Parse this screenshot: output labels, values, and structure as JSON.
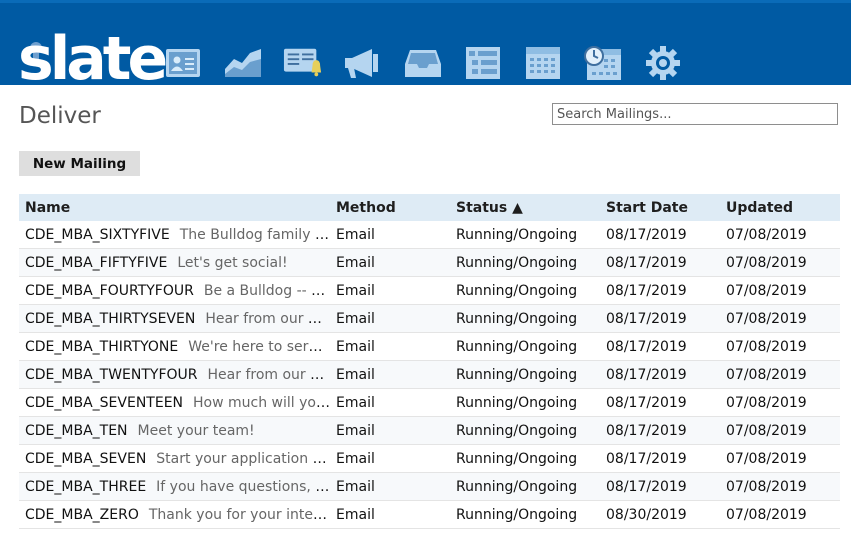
{
  "app": {
    "logo_text": "slate"
  },
  "nav": [
    {
      "name": "people-icon"
    },
    {
      "name": "reports-icon"
    },
    {
      "name": "forms-icon"
    },
    {
      "name": "campaigns-icon"
    },
    {
      "name": "inbox-icon"
    },
    {
      "name": "queries-icon"
    },
    {
      "name": "calendar-icon"
    },
    {
      "name": "schedule-icon"
    },
    {
      "name": "settings-icon"
    }
  ],
  "page": {
    "title": "Deliver"
  },
  "search": {
    "placeholder": "Search Mailings..."
  },
  "toolbar": {
    "new_label": "New Mailing"
  },
  "table": {
    "headers": {
      "name": "Name",
      "method": "Method",
      "status": "Status ▲",
      "start": "Start Date",
      "updated": "Updated"
    },
    "rows": [
      {
        "name": "CDE_MBA_SIXTYFIVE",
        "desc": "The Bulldog family wan...",
        "method": "Email",
        "status": "Running/Ongoing",
        "start": "08/17/2019",
        "updated": "07/08/2019"
      },
      {
        "name": "CDE_MBA_FIFTYFIVE",
        "desc": "Let's get social!",
        "method": "Email",
        "status": "Running/Ongoing",
        "start": "08/17/2019",
        "updated": "07/08/2019"
      },
      {
        "name": "CDE_MBA_FOURTYFOUR",
        "desc": "Be a Bulldog -- MS...",
        "method": "Email",
        "status": "Running/Ongoing",
        "start": "08/17/2019",
        "updated": "07/08/2019"
      },
      {
        "name": "CDE_MBA_THIRTYSEVEN",
        "desc": "Hear from our onli...",
        "method": "Email",
        "status": "Running/Ongoing",
        "start": "08/17/2019",
        "updated": "07/08/2019"
      },
      {
        "name": "CDE_MBA_THIRTYONE",
        "desc": "We're here to serve ...",
        "method": "Email",
        "status": "Running/Ongoing",
        "start": "08/17/2019",
        "updated": "07/08/2019"
      },
      {
        "name": "CDE_MBA_TWENTYFOUR",
        "desc": "Hear from our onli...",
        "method": "Email",
        "status": "Running/Ongoing",
        "start": "08/17/2019",
        "updated": "07/08/2019"
      },
      {
        "name": "CDE_MBA_SEVENTEEN",
        "desc": "How much will your ...",
        "method": "Email",
        "status": "Running/Ongoing",
        "start": "08/17/2019",
        "updated": "07/08/2019"
      },
      {
        "name": "CDE_MBA_TEN",
        "desc": "Meet your team!",
        "method": "Email",
        "status": "Running/Ongoing",
        "start": "08/17/2019",
        "updated": "07/08/2019"
      },
      {
        "name": "CDE_MBA_SEVEN",
        "desc": "Start your application toda...",
        "method": "Email",
        "status": "Running/Ongoing",
        "start": "08/17/2019",
        "updated": "07/08/2019"
      },
      {
        "name": "CDE_MBA_THREE",
        "desc": "If you have questions, we ...",
        "method": "Email",
        "status": "Running/Ongoing",
        "start": "08/17/2019",
        "updated": "07/08/2019"
      },
      {
        "name": "CDE_MBA_ZERO",
        "desc": "Thank you for your interest...",
        "method": "Email",
        "status": "Running/Ongoing",
        "start": "08/30/2019",
        "updated": "07/08/2019"
      }
    ]
  },
  "colors": {
    "header_bg": "#005aa3",
    "icon": "#b5d5f0",
    "table_header_bg": "#deebf5",
    "button_bg": "#dedede"
  }
}
